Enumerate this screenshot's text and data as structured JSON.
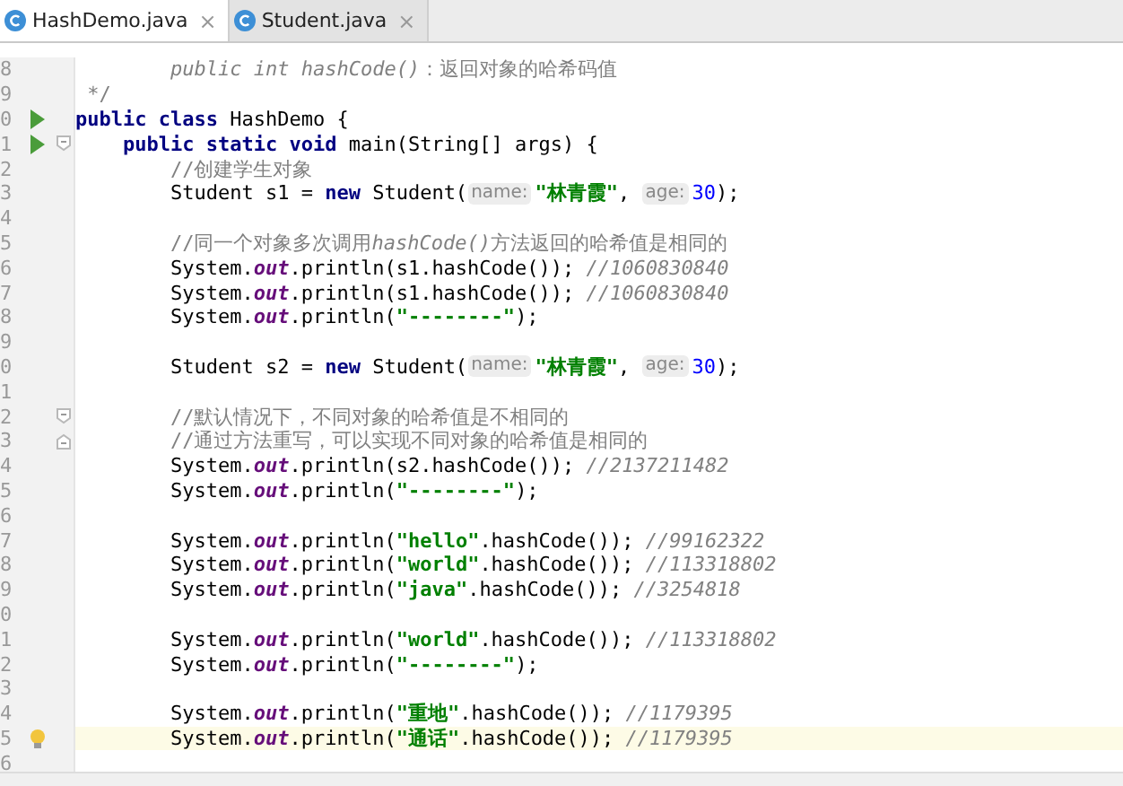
{
  "tabs": [
    {
      "label": "HashDemo.java",
      "close": "×",
      "selected": true
    },
    {
      "label": "Student.java",
      "close": "×",
      "selected": false
    }
  ],
  "lines": [
    {
      "number": "8",
      "current": false,
      "tokens": [
        {
          "kind": "comment",
          "text": "        *public int hashCode()*：返回对象的哈希码值"
        }
      ]
    },
    {
      "number": "9",
      "current": false,
      "tokens": [
        {
          "kind": "comment",
          "text": " */"
        }
      ]
    },
    {
      "number": "0",
      "current": false,
      "gutter_icons": [
        {
          "kind": "run"
        }
      ],
      "tokens": [
        {
          "kind": "keyword",
          "text": "public class "
        },
        {
          "kind": "plain",
          "text": "HashDemo {"
        }
      ]
    },
    {
      "number": "1",
      "current": false,
      "gutter_icons": [
        {
          "kind": "run"
        },
        {
          "kind": "fold-start"
        }
      ],
      "tokens": [
        {
          "kind": "keyword",
          "text": "    public static void "
        },
        {
          "kind": "plain",
          "text": "main(String[] args) {"
        }
      ]
    },
    {
      "number": "2",
      "current": false,
      "tokens": [
        {
          "kind": "comment",
          "text": "        //创建学生对象"
        }
      ]
    },
    {
      "number": "3",
      "current": false,
      "tokens": [
        {
          "kind": "plain",
          "text": "        Student s1 = "
        },
        {
          "kind": "keyword",
          "text": "new "
        },
        {
          "kind": "plain",
          "text": "Student("
        },
        {
          "kind": "hint",
          "text": "name:"
        },
        {
          "kind": "string",
          "text": "\"林青霞\""
        },
        {
          "kind": "plain",
          "text": ", "
        },
        {
          "kind": "hint",
          "text": "age:"
        },
        {
          "kind": "number",
          "text": "30"
        },
        {
          "kind": "plain",
          "text": ");"
        }
      ]
    },
    {
      "number": "4",
      "current": false
    },
    {
      "number": "5",
      "current": false,
      "tokens": [
        {
          "kind": "comment",
          "text": "        //同一个对象多次调用"
        },
        {
          "kind": "comment-italic",
          "text": "hashCode()"
        },
        {
          "kind": "comment",
          "text": "方法返回的哈希值是相同的"
        }
      ]
    },
    {
      "number": "6",
      "current": false,
      "tokens": [
        {
          "kind": "plain",
          "text": "        System."
        },
        {
          "kind": "field",
          "text": "out"
        },
        {
          "kind": "plain",
          "text": ".println(s1.hashCode()); "
        },
        {
          "kind": "comment",
          "text": "*//1060830840*"
        }
      ]
    },
    {
      "number": "7",
      "current": false,
      "tokens": [
        {
          "kind": "plain",
          "text": "        System."
        },
        {
          "kind": "field",
          "text": "out"
        },
        {
          "kind": "plain",
          "text": ".println(s1.hashCode()); "
        },
        {
          "kind": "comment",
          "text": "*//1060830840*"
        }
      ]
    },
    {
      "number": "8",
      "current": false,
      "tokens": [
        {
          "kind": "plain",
          "text": "        System."
        },
        {
          "kind": "field",
          "text": "out"
        },
        {
          "kind": "plain",
          "text": ".println("
        },
        {
          "kind": "string",
          "text": "\"--------\""
        },
        {
          "kind": "plain",
          "text": ");"
        }
      ]
    },
    {
      "number": "9",
      "current": false
    },
    {
      "number": "0",
      "current": false,
      "tokens": [
        {
          "kind": "plain",
          "text": "        Student s2 = "
        },
        {
          "kind": "keyword",
          "text": "new "
        },
        {
          "kind": "plain",
          "text": "Student("
        },
        {
          "kind": "hint",
          "text": "name:"
        },
        {
          "kind": "string",
          "text": "\"林青霞\""
        },
        {
          "kind": "plain",
          "text": ", "
        },
        {
          "kind": "hint",
          "text": "age:"
        },
        {
          "kind": "number",
          "text": "30"
        },
        {
          "kind": "plain",
          "text": ");"
        }
      ]
    },
    {
      "number": "1",
      "current": false
    },
    {
      "number": "2",
      "current": false,
      "gutter_icons": [
        {
          "kind": "fold-start"
        }
      ],
      "tokens": [
        {
          "kind": "comment",
          "text": "        //默认情况下，不同对象的哈希值是不相同的"
        }
      ]
    },
    {
      "number": "3",
      "current": false,
      "gutter_icons": [
        {
          "kind": "fold-end"
        }
      ],
      "tokens": [
        {
          "kind": "comment",
          "text": "        //通过方法重写，可以实现不同对象的哈希值是相同的"
        }
      ]
    },
    {
      "number": "4",
      "current": false,
      "tokens": [
        {
          "kind": "plain",
          "text": "        System."
        },
        {
          "kind": "field",
          "text": "out"
        },
        {
          "kind": "plain",
          "text": ".println(s2.hashCode()); "
        },
        {
          "kind": "comment",
          "text": "*//2137211482*"
        }
      ]
    },
    {
      "number": "5",
      "current": false,
      "tokens": [
        {
          "kind": "plain",
          "text": "        System."
        },
        {
          "kind": "field",
          "text": "out"
        },
        {
          "kind": "plain",
          "text": ".println("
        },
        {
          "kind": "string",
          "text": "\"--------\""
        },
        {
          "kind": "plain",
          "text": ");"
        }
      ]
    },
    {
      "number": "6",
      "current": false
    },
    {
      "number": "7",
      "current": false,
      "tokens": [
        {
          "kind": "plain",
          "text": "        System."
        },
        {
          "kind": "field",
          "text": "out"
        },
        {
          "kind": "plain",
          "text": ".println("
        },
        {
          "kind": "string",
          "text": "\"hello\""
        },
        {
          "kind": "plain",
          "text": ".hashCode()); "
        },
        {
          "kind": "comment",
          "text": "*//99162322*"
        }
      ]
    },
    {
      "number": "8",
      "current": false,
      "tokens": [
        {
          "kind": "plain",
          "text": "        System."
        },
        {
          "kind": "field",
          "text": "out"
        },
        {
          "kind": "plain",
          "text": ".println("
        },
        {
          "kind": "string",
          "text": "\"world\""
        },
        {
          "kind": "plain",
          "text": ".hashCode()); "
        },
        {
          "kind": "comment",
          "text": "*//113318802*"
        }
      ]
    },
    {
      "number": "9",
      "current": false,
      "tokens": [
        {
          "kind": "plain",
          "text": "        System."
        },
        {
          "kind": "field",
          "text": "out"
        },
        {
          "kind": "plain",
          "text": ".println("
        },
        {
          "kind": "string",
          "text": "\"java\""
        },
        {
          "kind": "plain",
          "text": ".hashCode()); "
        },
        {
          "kind": "comment",
          "text": "*//3254818*"
        }
      ]
    },
    {
      "number": "0",
      "current": false
    },
    {
      "number": "1",
      "current": false,
      "tokens": [
        {
          "kind": "plain",
          "text": "        System."
        },
        {
          "kind": "field",
          "text": "out"
        },
        {
          "kind": "plain",
          "text": ".println("
        },
        {
          "kind": "string",
          "text": "\"world\""
        },
        {
          "kind": "plain",
          "text": ".hashCode()); "
        },
        {
          "kind": "comment",
          "text": "*//113318802*"
        }
      ]
    },
    {
      "number": "2",
      "current": false,
      "tokens": [
        {
          "kind": "plain",
          "text": "        System."
        },
        {
          "kind": "field",
          "text": "out"
        },
        {
          "kind": "plain",
          "text": ".println("
        },
        {
          "kind": "string",
          "text": "\"--------\""
        },
        {
          "kind": "plain",
          "text": ");"
        }
      ]
    },
    {
      "number": "3",
      "current": false
    },
    {
      "number": "4",
      "current": false,
      "tokens": [
        {
          "kind": "plain",
          "text": "        System."
        },
        {
          "kind": "field",
          "text": "out"
        },
        {
          "kind": "plain",
          "text": ".println("
        },
        {
          "kind": "string",
          "text": "\"重地\""
        },
        {
          "kind": "plain",
          "text": ".hashCode()); "
        },
        {
          "kind": "comment",
          "text": "*//1179395*"
        }
      ]
    },
    {
      "number": "5",
      "current": true,
      "gutter_icons": [
        {
          "kind": "bulb"
        }
      ],
      "tokens": [
        {
          "kind": "plain",
          "text": "        System."
        },
        {
          "kind": "field",
          "text": "out"
        },
        {
          "kind": "plain",
          "text": ".println("
        },
        {
          "kind": "string",
          "text": "\"通话\""
        },
        {
          "kind": "plain",
          "text": ".hashCode()); "
        },
        {
          "kind": "comment",
          "text": "*//1179395*"
        }
      ]
    },
    {
      "number": "6",
      "current": false
    }
  ]
}
